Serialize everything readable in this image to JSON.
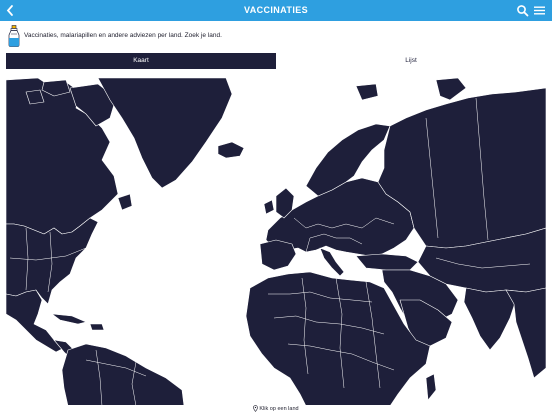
{
  "header": {
    "title": "VACCINATIES",
    "back_icon": "chevron-left-icon",
    "search_icon": "search-icon",
    "menu_icon": "hamburger-menu-icon",
    "bar_color": "#2e9fe0"
  },
  "intro": {
    "icon": "vaccine-bottle-icon",
    "text": "Vaccinaties, malariapillen en andere adviezen per land. Zoek je land."
  },
  "tabs": [
    {
      "label": "Kaart",
      "active": true
    },
    {
      "label": "Lijst",
      "active": false
    }
  ],
  "map": {
    "land_color": "#1e1f3a",
    "water_color": "#ffffff",
    "regions": [
      "Noord-Amerika",
      "Groenland",
      "Europa",
      "Afrika",
      "Midden-Oosten",
      "Azië",
      "Zuid-Amerika"
    ]
  },
  "hint": {
    "icon": "location-pin-icon",
    "text": "Klik op een land"
  }
}
